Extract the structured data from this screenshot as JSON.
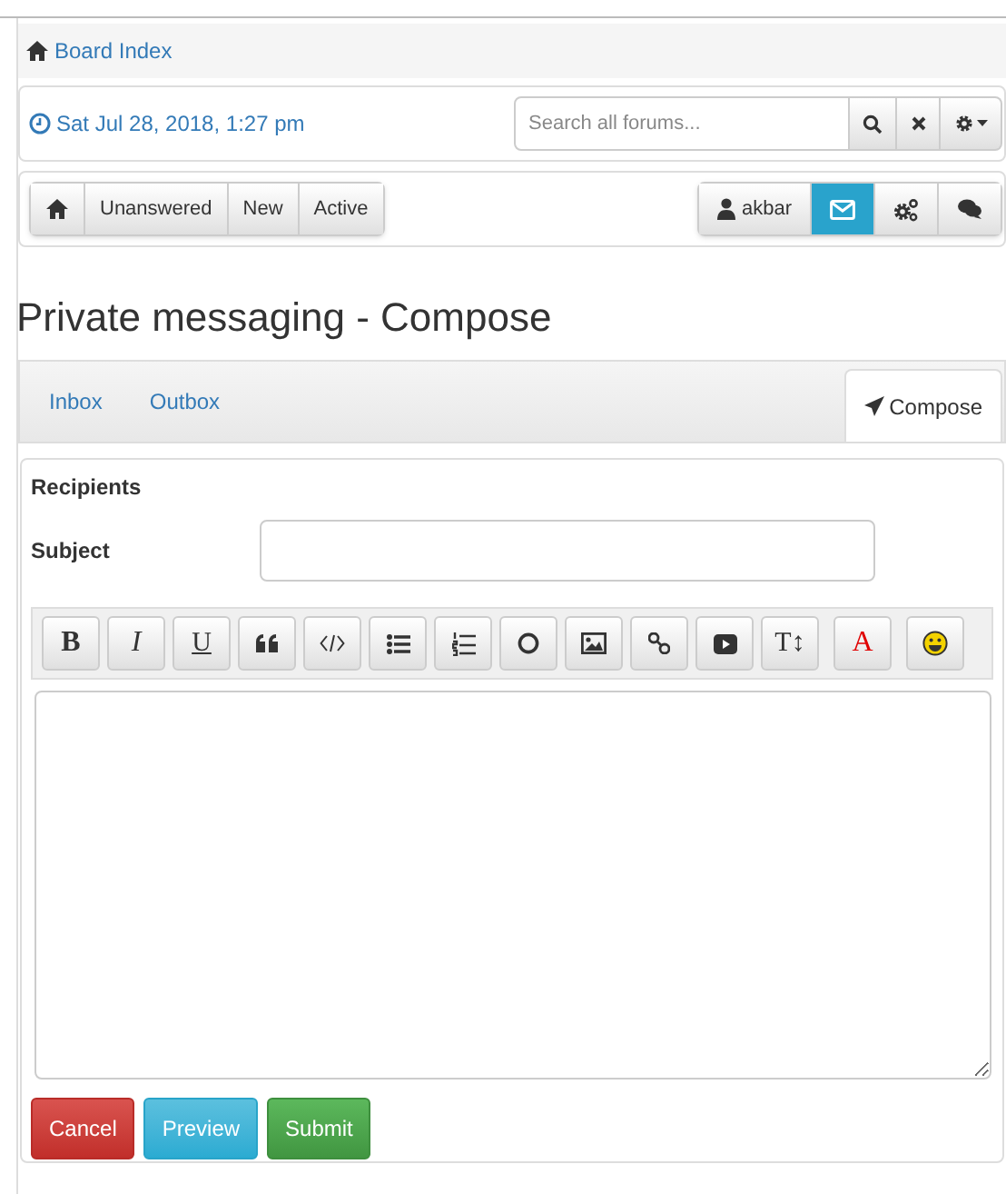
{
  "breadcrumb": {
    "label": "Board Index"
  },
  "info_bar": {
    "datetime": "Sat Jul 28, 2018, 1:27 pm",
    "search": {
      "placeholder": "Search all forums..."
    }
  },
  "nav_left": [
    {
      "kind": "home"
    },
    {
      "kind": "link",
      "label": "Unanswered"
    },
    {
      "kind": "link",
      "label": "New"
    },
    {
      "kind": "link",
      "label": "Active"
    }
  ],
  "nav_right": [
    {
      "kind": "user",
      "label": "akbar",
      "active": false
    },
    {
      "kind": "messages",
      "active": true
    },
    {
      "kind": "settings",
      "active": false
    },
    {
      "kind": "chat",
      "active": false
    }
  ],
  "page_title": "Private messaging - Compose",
  "tabs": [
    {
      "label": "Inbox",
      "selected": false
    },
    {
      "label": "Outbox",
      "selected": false
    },
    {
      "label": "Compose",
      "selected": true
    }
  ],
  "form": {
    "recipients_label": "Recipients",
    "subject_label": "Subject"
  },
  "toolbar": [
    {
      "kind": "bold",
      "label": "B"
    },
    {
      "kind": "italic",
      "label": "I"
    },
    {
      "kind": "underline",
      "label": "U"
    },
    {
      "kind": "quote"
    },
    {
      "kind": "code"
    },
    {
      "kind": "list"
    },
    {
      "kind": "numbered-list"
    },
    {
      "kind": "circle"
    },
    {
      "kind": "image"
    },
    {
      "kind": "link"
    },
    {
      "kind": "video"
    },
    {
      "kind": "size",
      "label": "T↕"
    },
    {
      "kind": "color",
      "label": "A"
    },
    {
      "kind": "smiley"
    }
  ],
  "buttons": [
    {
      "kind": "danger",
      "label": "Cancel"
    },
    {
      "kind": "info",
      "label": "Preview"
    },
    {
      "kind": "success",
      "label": "Submit"
    }
  ]
}
